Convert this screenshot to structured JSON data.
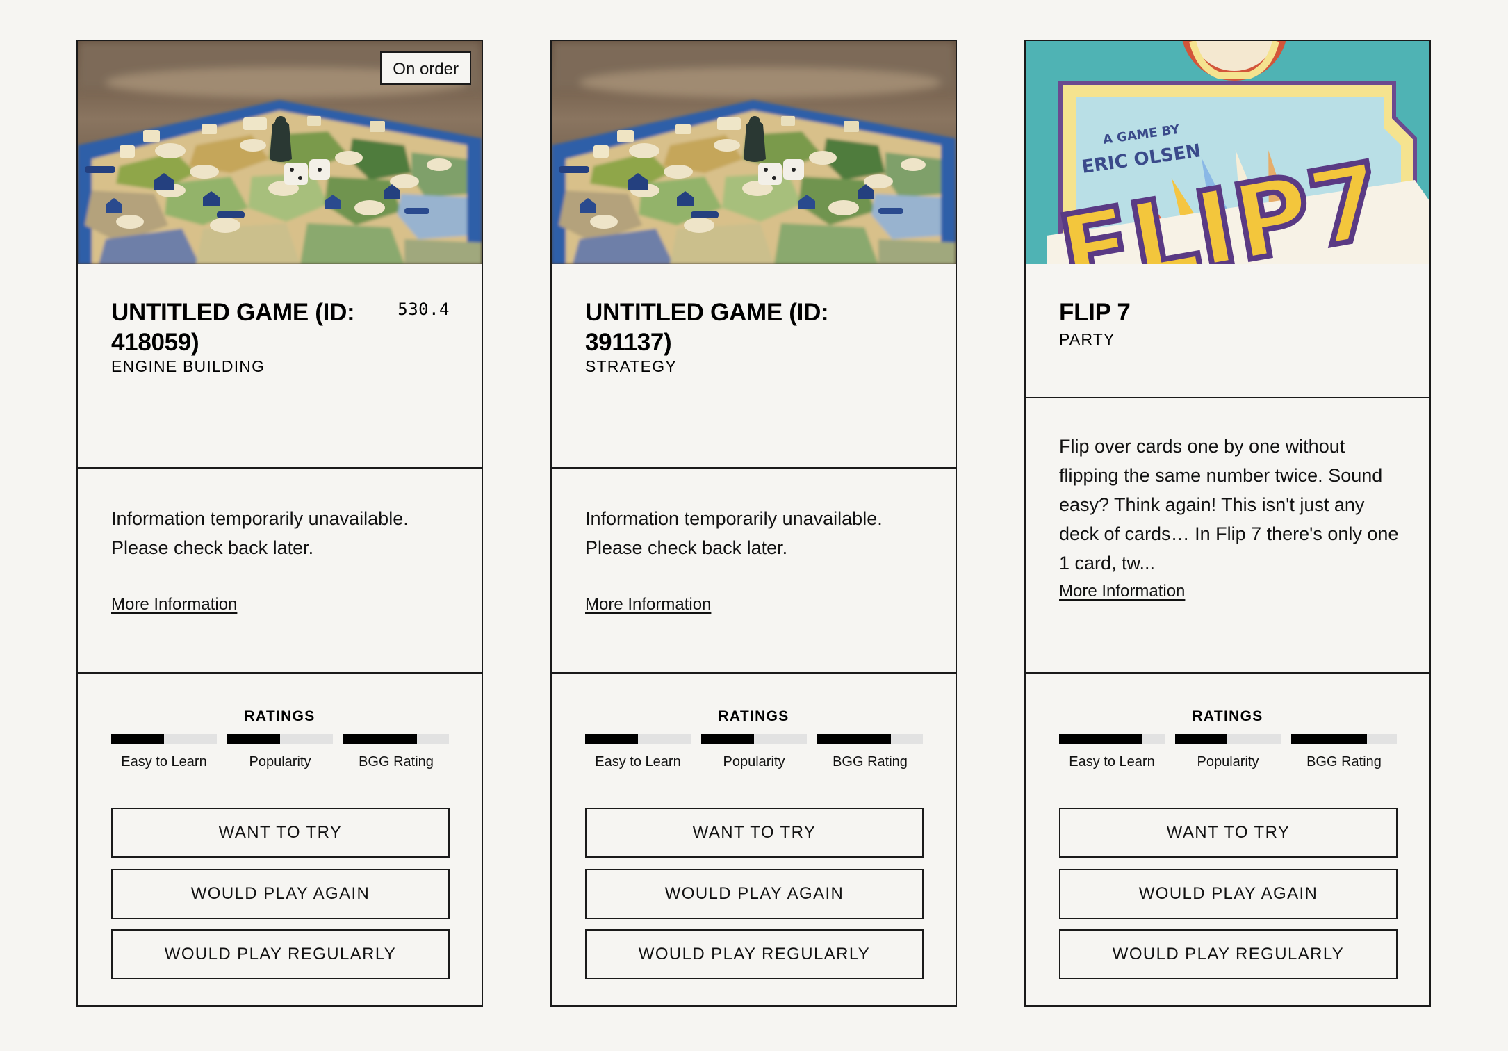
{
  "cards": [
    {
      "title": "UNTITLED GAME (ID: 418059)",
      "category": "ENGINE BUILDING",
      "score": "530.4",
      "badge": "On order",
      "image": "board-game-photo",
      "description": "Information temporarily unavailable. Please check back later.",
      "more_link": "More Information",
      "ratings_title": "RATINGS",
      "ratings": [
        {
          "label": "Easy to Learn",
          "value": 0.5
        },
        {
          "label": "Popularity",
          "value": 0.5
        },
        {
          "label": "BGG Rating",
          "value": 0.7
        }
      ],
      "actions": [
        "WANT TO TRY",
        "WOULD PLAY AGAIN",
        "WOULD PLAY REGULARLY"
      ]
    },
    {
      "title": "UNTITLED GAME (ID: 391137)",
      "category": "STRATEGY",
      "image": "board-game-photo",
      "description": "Information temporarily unavailable. Please check back later.",
      "more_link": "More Information",
      "ratings_title": "RATINGS",
      "ratings": [
        {
          "label": "Easy to Learn",
          "value": 0.5
        },
        {
          "label": "Popularity",
          "value": 0.5
        },
        {
          "label": "BGG Rating",
          "value": 0.7
        }
      ],
      "actions": [
        "WANT TO TRY",
        "WOULD PLAY AGAIN",
        "WOULD PLAY REGULARLY"
      ]
    },
    {
      "title": "FLIP 7",
      "category": "PARTY",
      "image": "flip-7-box-art",
      "description": "Flip over cards one by one without flipping the same number twice. Sound easy? Think again! This isn't just any deck of cards… In Flip 7 there's only one 1 card, tw...",
      "more_link": "More Information",
      "ratings_title": "RATINGS",
      "ratings": [
        {
          "label": "Easy to Learn",
          "value": 0.78
        },
        {
          "label": "Popularity",
          "value": 0.49
        },
        {
          "label": "BGG Rating",
          "value": 0.72
        }
      ],
      "actions": [
        "WANT TO TRY",
        "WOULD PLAY AGAIN",
        "WOULD PLAY REGULARLY"
      ],
      "box_art": {
        "byline_1": "A GAME BY",
        "byline_2": "ERIC OLSEN",
        "logo": "FLIP7"
      }
    }
  ]
}
